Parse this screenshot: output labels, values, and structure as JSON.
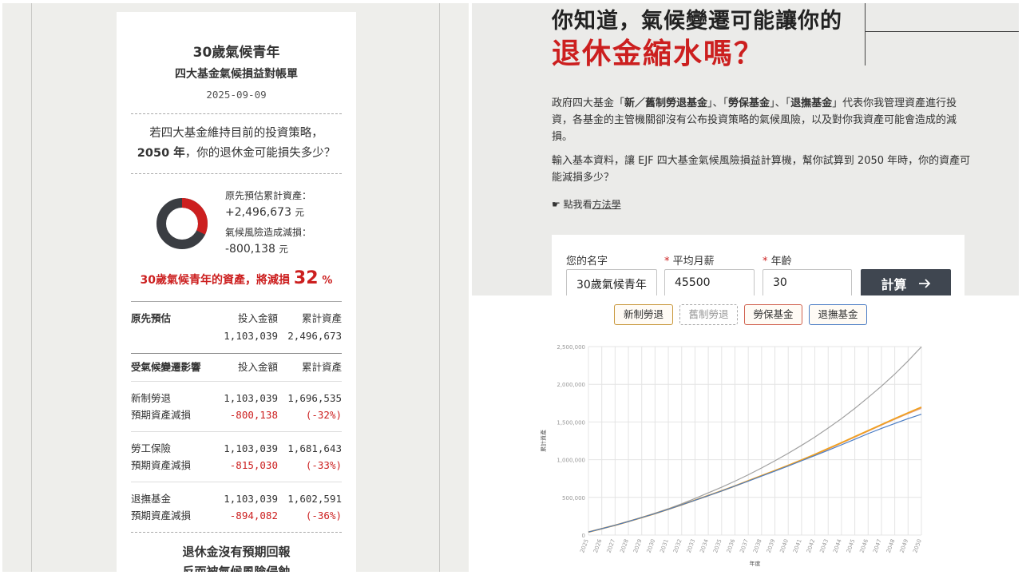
{
  "receipt": {
    "title": "30歲氣候青年",
    "subtitle": "四大基金氣候損益對帳單",
    "date": "2025-09-09",
    "question_line1": "若四大基金維持目前的投資策略，",
    "question_year": "2050 年",
    "question_line2_rest": "，你的退休金可能損失多少？",
    "original_label": "原先預估累計資產：",
    "original_value": "+2,496,673",
    "unit": "元",
    "loss_label": "氣候風險造成減損：",
    "loss_value": "-800,138",
    "loss_share": 0.32,
    "loss_text": "30歲氣候青年的資產，將減損",
    "loss_pct": "32",
    "loss_pct_unit": "%",
    "colors": {
      "accent_red": "#cc1f1f",
      "donut_dark": "#3a3d42"
    },
    "original_table": {
      "title": "原先預估",
      "col_invest": "投入金額",
      "col_total": "累計資產",
      "invest": "1,103,039",
      "total": "2,496,673"
    },
    "impact_table": {
      "title": "受氣候變遷影響",
      "col_invest": "投入金額",
      "col_total": "累計資產",
      "rows": [
        {
          "fund": "新制勞退",
          "invest": "1,103,039",
          "total": "1,696,535",
          "sub_label": "預期資產減損",
          "loss": "-800,138",
          "pct": "(-32%)"
        },
        {
          "fund": "勞工保險",
          "invest": "1,103,039",
          "total": "1,681,643",
          "sub_label": "預期資產減損",
          "loss": "-815,030",
          "pct": "(-33%)"
        },
        {
          "fund": "退撫基金",
          "invest": "1,103,039",
          "total": "1,602,591",
          "sub_label": "預期資產減損",
          "loss": "-894,082",
          "pct": "(-36%)"
        }
      ]
    },
    "footer_line1": "退休金沒有預期回報",
    "footer_line2": "反而被氣候風險侵蝕"
  },
  "intro": {
    "headline_line1": "你知道，氣候變遷可能讓你的",
    "headline_line2": "退休金縮水嗎？",
    "para1_pre": "政府四大基金「",
    "para1_b1": "新／舊制勞退基金",
    "para1_mid1": "」、「",
    "para1_b2": "勞保基金",
    "para1_mid2": "」、「",
    "para1_b3": "退撫基金",
    "para1_post": "」代表你我管理資產進行投資，各基金的主管機關卻沒有公布投資策略的氣候風險，以及對你我資產可能會造成的減損。",
    "para2": "輸入基本資料，讓 EJF 四大基金氣候風險損益計算機，幫你試算到 2050 年時，你的資產可能減損多少？",
    "method_prefix": "☛ 點我看",
    "method_link": "方法學",
    "form": {
      "name_label": "您的名字",
      "salary_label": "平均月薪",
      "age_label": "年齡",
      "required_mark": "*",
      "name_value": "30歲氣候青年",
      "salary_value": "45500",
      "age_value": "30",
      "submit_label": "計算",
      "submit_icon": "arrow-right-icon"
    }
  },
  "chart_tags": [
    {
      "label": "新制勞退",
      "color": "#c8973a",
      "active": true
    },
    {
      "label": "舊制勞退",
      "color": "#aaaaaa",
      "active": false
    },
    {
      "label": "勞保基金",
      "color": "#d0604e",
      "active": true
    },
    {
      "label": "退撫基金",
      "color": "#4a7cc4",
      "active": true
    }
  ],
  "chart_data": {
    "type": "line",
    "xlabel": "年度",
    "ylabel": "累計資產",
    "ylim": [
      0,
      2500000
    ],
    "yticks": [
      "0",
      "500,000",
      "1,000,000",
      "1,500,000",
      "2,000,000",
      "2,500,000"
    ],
    "x": [
      2025,
      2026,
      2027,
      2028,
      2029,
      2030,
      2031,
      2032,
      2033,
      2034,
      2035,
      2036,
      2037,
      2038,
      2039,
      2040,
      2041,
      2042,
      2043,
      2044,
      2045,
      2046,
      2047,
      2048,
      2049,
      2050
    ],
    "grid": true,
    "series": [
      {
        "name": "原先預估",
        "color": "#a0a0a0",
        "values": [
          40000,
          85000,
          130000,
          180000,
          235000,
          290000,
          350000,
          415000,
          485000,
          560000,
          635000,
          715000,
          800000,
          890000,
          985000,
          1085000,
          1190000,
          1300000,
          1420000,
          1545000,
          1680000,
          1825000,
          1975000,
          2135000,
          2310000,
          2496673
        ]
      },
      {
        "name": "勞保基金",
        "color": "#e0a08c",
        "values": [
          40000,
          85000,
          130000,
          180000,
          232000,
          285000,
          342000,
          402000,
          462000,
          522000,
          585000,
          650000,
          718000,
          785000,
          852000,
          920000,
          990000,
          1065000,
          1140000,
          1218000,
          1298000,
          1378000,
          1458000,
          1535000,
          1610000,
          1681643
        ]
      },
      {
        "name": "新制勞退",
        "color": "#f0a020",
        "values": [
          40000,
          85000,
          130000,
          180000,
          232000,
          285000,
          342000,
          402000,
          463000,
          524000,
          587000,
          652000,
          720000,
          788000,
          856000,
          925000,
          996000,
          1071000,
          1148000,
          1226000,
          1306000,
          1386000,
          1465000,
          1545000,
          1622000,
          1696535
        ]
      },
      {
        "name": "退撫基金",
        "color": "#4a7cc4",
        "values": [
          40000,
          85000,
          130000,
          180000,
          232000,
          285000,
          342000,
          402000,
          462000,
          522000,
          585000,
          650000,
          716000,
          782000,
          848000,
          915000,
          985000,
          1055000,
          1125000,
          1197000,
          1270000,
          1345000,
          1415000,
          1480000,
          1545000,
          1602591
        ]
      }
    ]
  }
}
